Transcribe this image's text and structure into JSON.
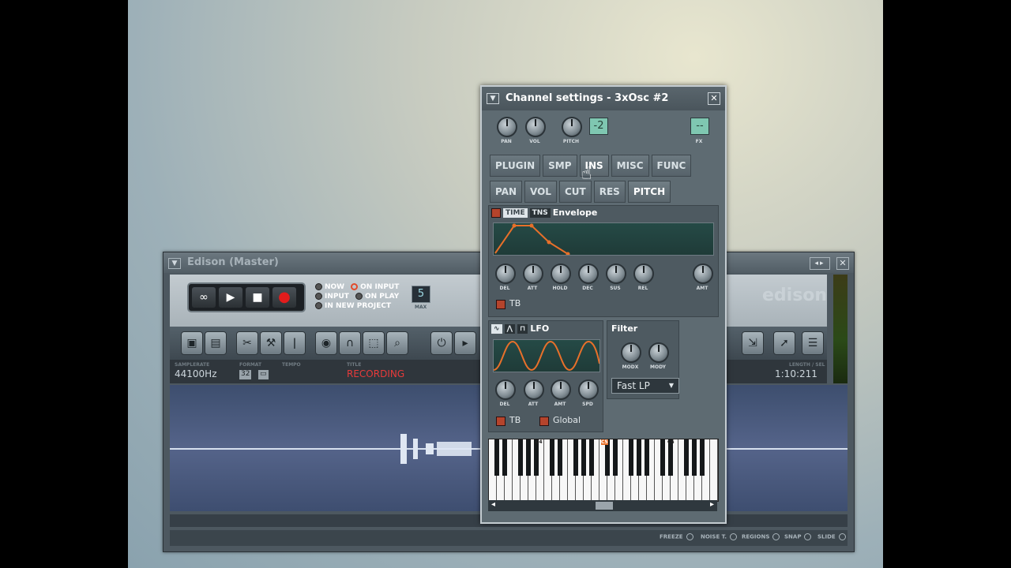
{
  "edison": {
    "title": "Edison (Master)",
    "options": {
      "now": "NOW",
      "input": "INPUT",
      "on_input": "ON INPUT",
      "on_play": "ON PLAY",
      "in_new_project": "IN NEW PROJECT"
    },
    "max_value": "5",
    "max_label": "MAX",
    "logo": "edison",
    "info": {
      "samplerate_label": "SAMPLERATE",
      "samplerate": "44100Hz",
      "format_label": "FORMAT",
      "format": "32",
      "tempo_label": "TEMPO",
      "title_label": "TITLE",
      "title": "RECORDING",
      "length_label": "LENGTH / SEL",
      "length": "1:10:211"
    },
    "bottom": {
      "freeze": "FREEZE",
      "noise": "NOISE T.",
      "regions": "REGIONS",
      "snap": "SNAP",
      "slide": "SLIDE"
    }
  },
  "channel": {
    "title": "Channel settings - 3xOsc #2",
    "knobs": {
      "pan": "PAN",
      "vol": "VOL",
      "pitch": "PITCH",
      "fx": "FX"
    },
    "pitch_value": "-2",
    "fx_value": "--",
    "tabs_row1": [
      "PLUGIN",
      "SMP",
      "INS",
      "MISC",
      "FUNC"
    ],
    "tabs_row2": [
      "PAN",
      "VOL",
      "CUT",
      "RES",
      "PITCH"
    ],
    "envelope": {
      "chip_time": "TIME",
      "chip_tns": "TNS",
      "label": "Envelope",
      "knobs": [
        "DEL",
        "ATT",
        "HOLD",
        "DEC",
        "SUS",
        "REL"
      ],
      "amt": "AMT",
      "tb": "TB"
    },
    "lfo": {
      "label": "LFO",
      "knobs": [
        "DEL",
        "ATT",
        "AMT",
        "SPD"
      ],
      "tb": "TB",
      "global": "Global"
    },
    "filter": {
      "label": "Filter",
      "knobs": [
        "MODX",
        "MODY"
      ],
      "type": "Fast LP"
    },
    "piano": {
      "c4": "C4",
      "c5": "C5",
      "c6": "C6"
    }
  },
  "colors": {
    "accent_red": "#e73a3a",
    "lcd": "#7fc7b1",
    "envelope_line": "#e8702a"
  }
}
